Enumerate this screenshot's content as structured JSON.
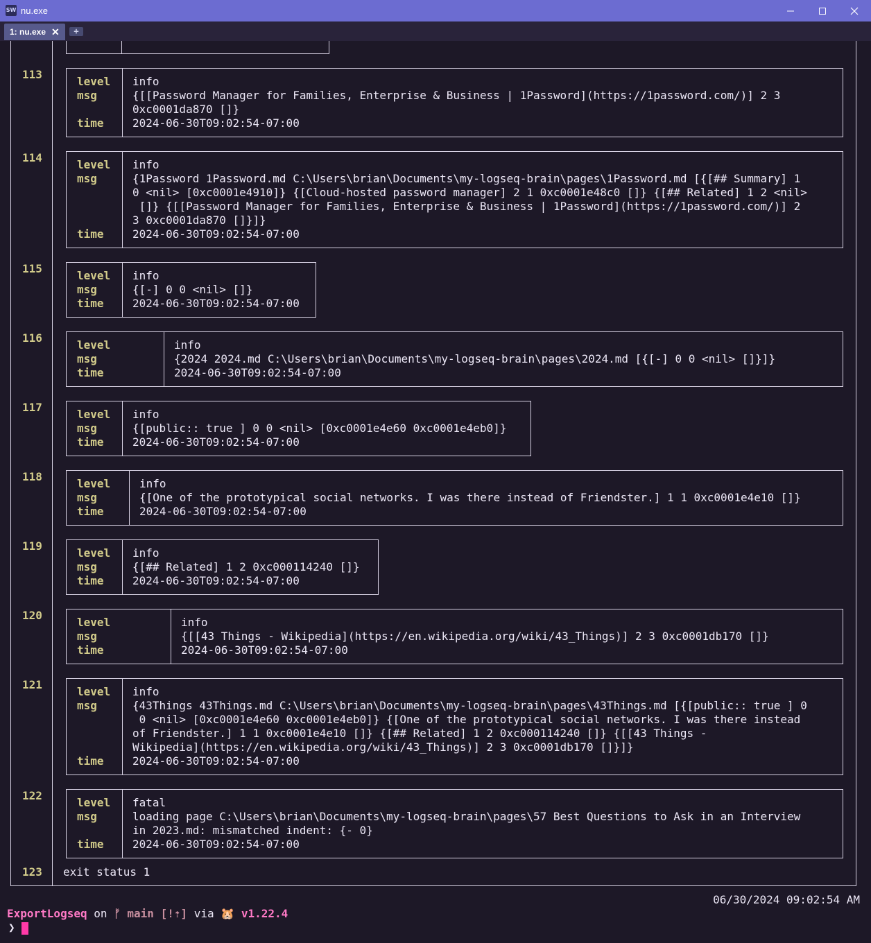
{
  "window": {
    "title": "nu.exe",
    "icon_label": "SW"
  },
  "tabs": [
    {
      "label": "1: nu.exe",
      "close_glyph": "✕"
    }
  ],
  "new_tab_glyph": "+",
  "labels": {
    "level": "level",
    "msg": "msg",
    "time": "time"
  },
  "records": [
    {
      "index": "113",
      "level": "info",
      "msg": [
        "{[[Password Manager for Families, Enterprise & Business | 1Password](https://1password.com/)] 2 3",
        "0xc0001da870 []}"
      ],
      "time": "2024-06-30T09:02:54-07:00"
    },
    {
      "index": "114",
      "level": "info",
      "msg": [
        "{1Password 1Password.md C:\\Users\\brian\\Documents\\my-logseq-brain\\pages\\1Password.md [{[## Summary] 1",
        "0 <nil> [0xc0001e4910]} {[Cloud-hosted password manager] 2 1 0xc0001e48c0 []} {[## Related] 1 2 <nil>",
        " []} {[[Password Manager for Families, Enterprise & Business | 1Password](https://1password.com/)] 2",
        "3 0xc0001da870 []}]}"
      ],
      "time": "2024-06-30T09:02:54-07:00"
    },
    {
      "index": "115",
      "level": "info",
      "msg": [
        "{[-] 0 0 <nil> []}"
      ],
      "time": "2024-06-30T09:02:54-07:00"
    },
    {
      "index": "116",
      "level": "info",
      "msg": [
        "{2024 2024.md C:\\Users\\brian\\Documents\\my-logseq-brain\\pages\\2024.md [{[-] 0 0 <nil> []}]}"
      ],
      "time": "2024-06-30T09:02:54-07:00"
    },
    {
      "index": "117",
      "level": "info",
      "msg": [
        "{[public:: true ] 0 0 <nil> [0xc0001e4e60 0xc0001e4eb0]}"
      ],
      "time": "2024-06-30T09:02:54-07:00"
    },
    {
      "index": "118",
      "level": "info",
      "msg": [
        "{[One of the prototypical social networks. I was there instead of Friendster.] 1 1 0xc0001e4e10 []}"
      ],
      "time": "2024-06-30T09:02:54-07:00"
    },
    {
      "index": "119",
      "level": "info",
      "msg": [
        "{[## Related] 1 2 0xc000114240 []}"
      ],
      "time": "2024-06-30T09:02:54-07:00"
    },
    {
      "index": "120",
      "level": "info",
      "msg": [
        "{[[43 Things - Wikipedia](https://en.wikipedia.org/wiki/43_Things)] 2 3 0xc0001db170 []}"
      ],
      "time": "2024-06-30T09:02:54-07:00"
    },
    {
      "index": "121",
      "level": "info",
      "msg": [
        "{43Things 43Things.md C:\\Users\\brian\\Documents\\my-logseq-brain\\pages\\43Things.md [{[public:: true ] 0",
        " 0 <nil> [0xc0001e4e60 0xc0001e4eb0]} {[One of the prototypical social networks. I was there instead",
        "of Friendster.] 1 1 0xc0001e4e10 []} {[## Related] 1 2 0xc000114240 []} {[[43 Things -",
        "Wikipedia](https://en.wikipedia.org/wiki/43_Things)] 2 3 0xc0001db170 []}]}"
      ],
      "time": "2024-06-30T09:02:54-07:00"
    },
    {
      "index": "122",
      "level": "fatal",
      "msg": [
        "loading page C:\\Users\\brian\\Documents\\my-logseq-brain\\pages\\57 Best Questions to Ask in an Interview",
        "in 2023.md: mismatched indent: {- 0}"
      ],
      "time": "2024-06-30T09:02:54-07:00"
    }
  ],
  "final": {
    "index": "123",
    "text": "exit status 1"
  },
  "clock": "06/30/2024 09:02:54 AM",
  "prompt": {
    "dir": "ExportLogseq",
    "on": "on",
    "branch_icon": "ᚠ",
    "branch": "main",
    "status": "[!⇡]",
    "via": "via",
    "runtime_icon": "🐹",
    "version": "v1.22.4",
    "symbol": "❯"
  },
  "colors": {
    "background": "#1d1827",
    "titlebar": "#6c6cd1",
    "key": "#d3cc8b",
    "prompt_dir": "#ff79c6",
    "cursor": "#ff3aa8"
  }
}
